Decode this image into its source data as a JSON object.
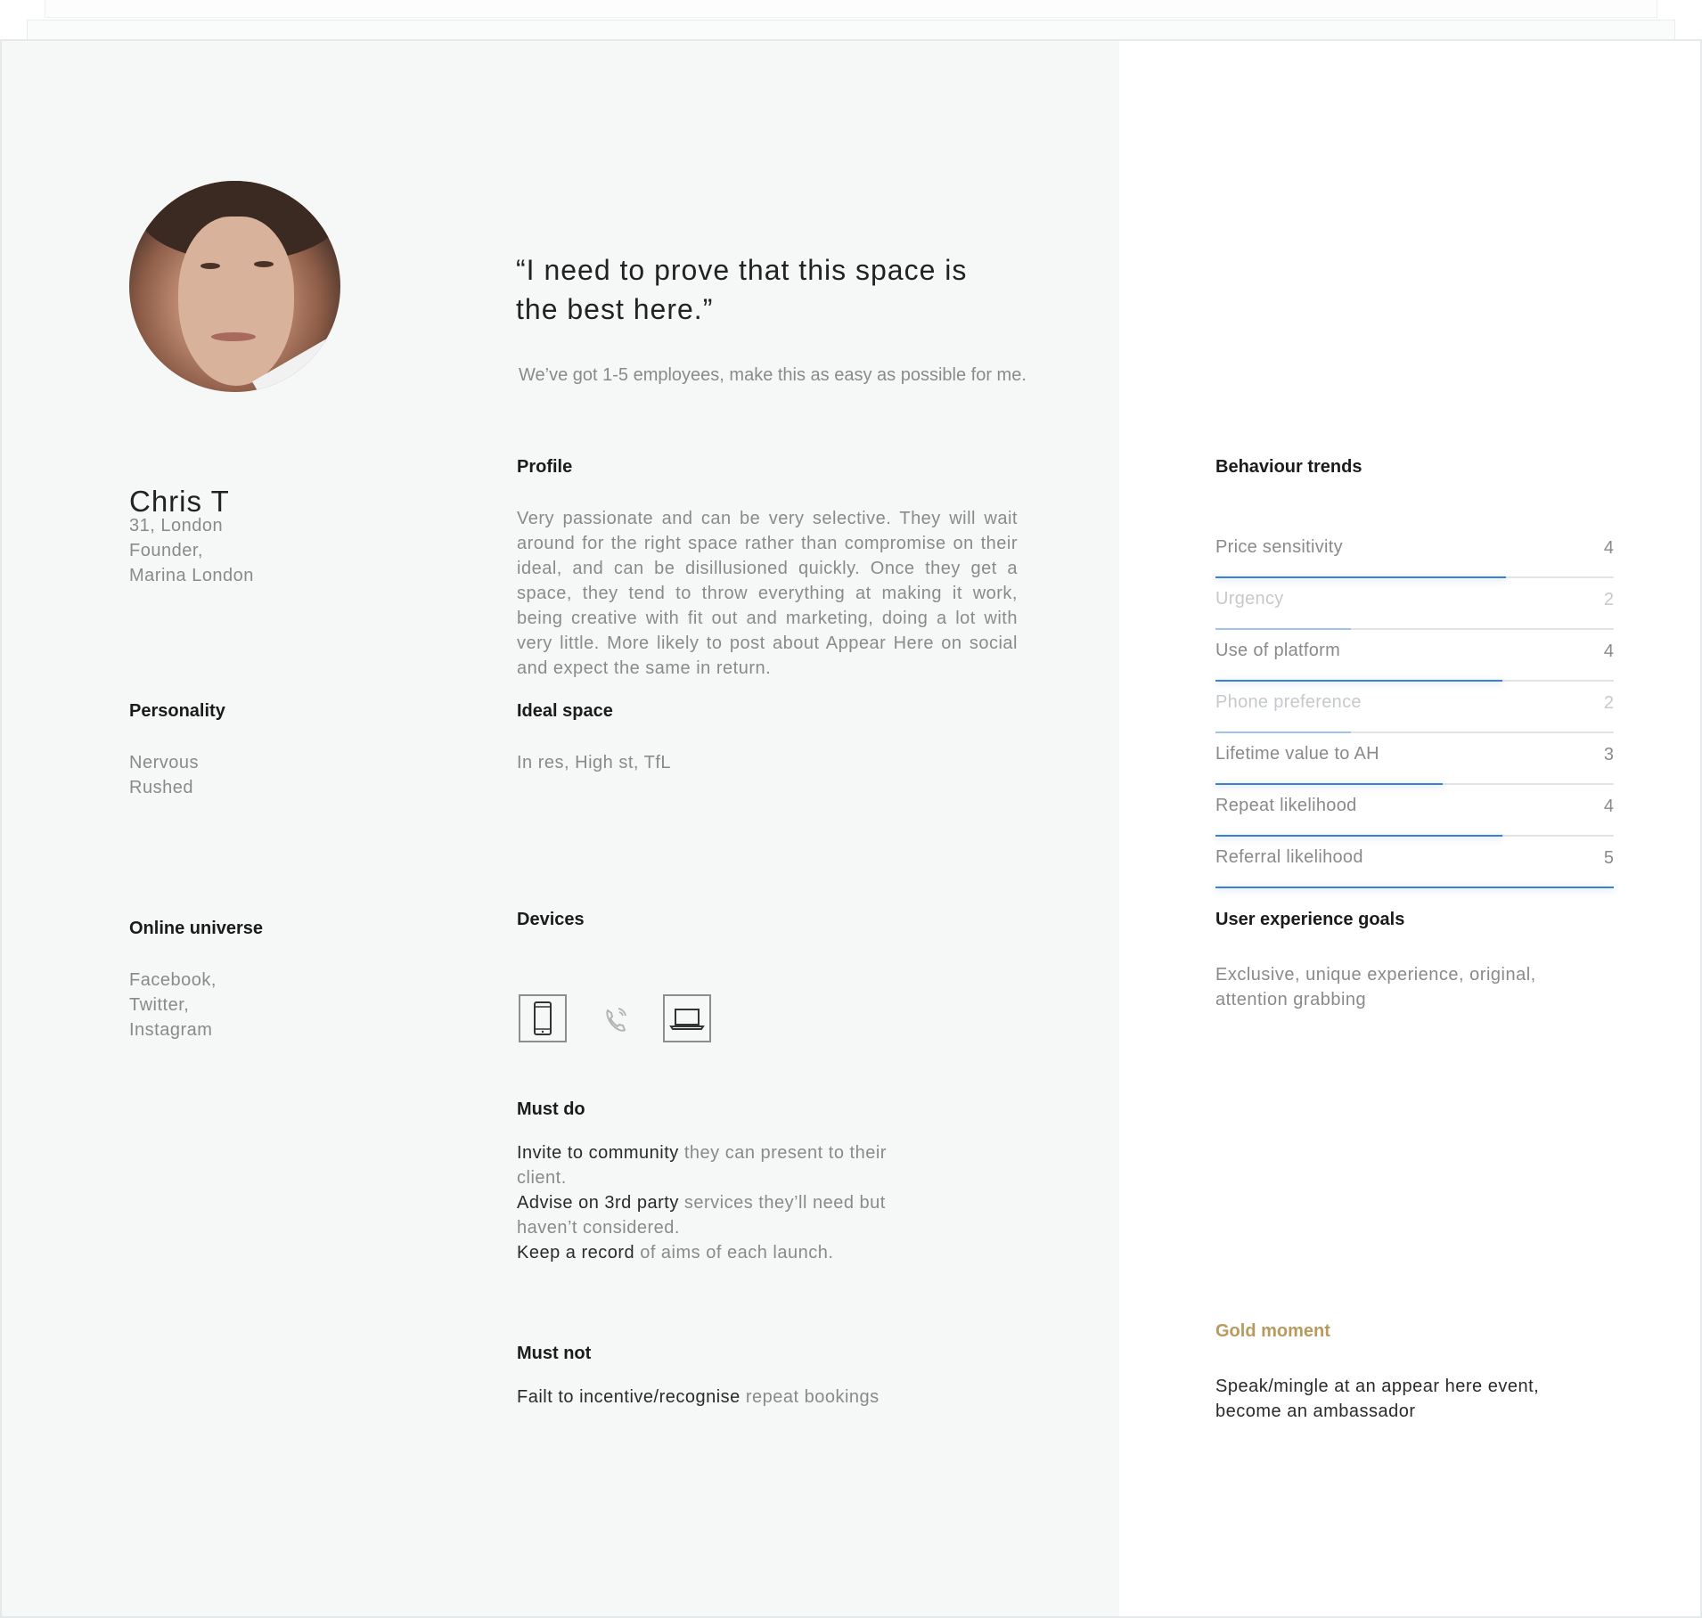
{
  "persona": {
    "quote": "“I need to prove that this space is the best here.”",
    "subquote": "We’ve got 1-5 employees, make this as easy as possible for me.",
    "name": "Chris T",
    "details": [
      "31, London",
      "Founder,",
      "Marina London"
    ]
  },
  "profile": {
    "heading": "Profile",
    "text": "Very passionate and can be very selective. They will wait around for the right space rather than compromise on their ideal, and can be disillusioned quickly. Once they get a space, they tend to throw everything at making it work, being creative with fit out and marketing, doing a lot with very little. More likely to post about Appear Here on social and expect the same in return."
  },
  "personality": {
    "heading": "Personality",
    "items": [
      "Nervous",
      "Rushed"
    ]
  },
  "ideal_space": {
    "heading": "Ideal space",
    "text": "In res, High st, TfL"
  },
  "online_universe": {
    "heading": "Online universe",
    "items": [
      "Facebook,",
      "Twitter,",
      "Instagram"
    ]
  },
  "devices": {
    "heading": "Devices",
    "icons": [
      "mobile-phone-icon",
      "phone-call-icon",
      "laptop-icon"
    ]
  },
  "must_do": {
    "heading": "Must do",
    "lines": [
      {
        "strong": "Invite to community",
        "rest": " they can present to their"
      },
      {
        "strong": "",
        "rest": "client."
      },
      {
        "strong": "Advise on 3rd party",
        "rest": " services they’ll need but"
      },
      {
        "strong": "",
        "rest": "haven’t considered."
      },
      {
        "strong": "Keep a record",
        "rest": " of aims of each launch."
      }
    ]
  },
  "must_not": {
    "heading": "Must not",
    "strong": "Failt to incentive/recognise",
    "rest": " repeat bookings"
  },
  "behaviour_trends": {
    "heading": "Behaviour trends",
    "max": 5,
    "items": [
      {
        "label": "Price sensitivity",
        "value": 4,
        "level": 0.73,
        "faded": false
      },
      {
        "label": "Urgency",
        "value": 2,
        "level": 0.34,
        "faded": true
      },
      {
        "label": "Use of platform",
        "value": 4,
        "level": 0.72,
        "faded": false
      },
      {
        "label": "Phone preference",
        "value": 2,
        "level": 0.34,
        "faded": true
      },
      {
        "label": "Lifetime value to AH",
        "value": 3,
        "level": 0.57,
        "faded": false
      },
      {
        "label": "Repeat likelihood",
        "value": 4,
        "level": 0.72,
        "faded": false
      },
      {
        "label": "Referral likelihood",
        "value": 5,
        "level": 1.0,
        "faded": false
      }
    ]
  },
  "ux_goals": {
    "heading": "User experience goals",
    "lines": [
      "Exclusive, unique experience, original,",
      "attention grabbing"
    ]
  },
  "gold_moment": {
    "heading": "Gold moment",
    "lines": [
      "Speak/mingle at an appear here event,",
      "become an ambassador"
    ],
    "color": "#b99a5e"
  },
  "colors": {
    "accent": "#3a7fd8",
    "left_panel_bg": "#f6f7f7"
  }
}
